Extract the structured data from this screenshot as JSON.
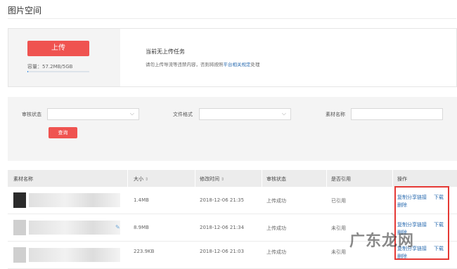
{
  "page": {
    "title": "图片空间"
  },
  "upload": {
    "button_label": "上传",
    "quota_text": "容量：57.2MB/5GB",
    "quota_fraction": 0.011,
    "task_title": "当前无上传任务",
    "notice_prefix": "请勿上传导流等违禁内容，否则将按照",
    "notice_link": "平台相关规定",
    "notice_suffix": "处理"
  },
  "filters": {
    "review_status_label": "审核状态",
    "file_format_label": "文件格式",
    "material_name_label": "素材名称",
    "query_button": "查询"
  },
  "table": {
    "headers": {
      "name": "素材名称",
      "size": "大小",
      "modified": "修改时间",
      "review": "审核状态",
      "referenced": "是否引用",
      "actions": "操作"
    },
    "rows": [
      {
        "size": "1.4MB",
        "modified": "2018-12-06 21:35",
        "review": "上传成功",
        "referenced": "已引用"
      },
      {
        "size": "8.9MB",
        "modified": "2018-12-06 21:34",
        "review": "上传成功",
        "referenced": "未引用"
      },
      {
        "size": "223.9KB",
        "modified": "2018-12-06 21:03",
        "review": "上传成功",
        "referenced": "未引用"
      }
    ],
    "actions": {
      "copy_link": "复制分享链接",
      "download": "下载",
      "delete": "删除"
    }
  },
  "watermark": {
    "text": "广东龙网"
  },
  "colors": {
    "primary": "#ef5350",
    "link": "#2b6cb0",
    "highlight_box": "#e53935"
  }
}
